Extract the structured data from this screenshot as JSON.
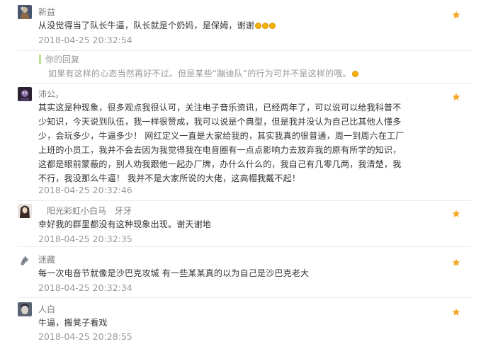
{
  "comments": [
    {
      "user": "新益",
      "text": "从没觉得当了队长牛逼，队长就是个奶妈，是保姆，谢谢",
      "time": "2018-04-25 20:32:54",
      "avatar_icon": "warrior-avatar-icon",
      "reply": {
        "title": "你的回复",
        "text": "如果有这样的心态当然再好不过。但是某些“蹦迪队”的行为可并不是这样的哦。"
      }
    },
    {
      "user": "沛公。",
      "text": "其实这是种现象，很多观点我很认可，关注电子音乐资讯，已经两年了，可以说可以给我科普不少知识，今天说到队伍，我一样很赞成，我可以说是个典型，但是我并没认为自己比其他人懂多少，会玩多少，牛逼多少！ 网红定义一直是大家给我的，其实我真的很普通，周一到周六在工厂上班的小员工，我并不会去因为我觉得我在电音圈有一点点影响力去放弃我的原有所学的知识，这都是眼前蒙蔽的，别人劝我跟他一起办厂牌，办什么什么的，我自己有几零几两，我清楚，我不行，我没那么牛逼！ 我并不是大家所说的大佬，这高帽我戴不起！",
      "time": "2018-04-25 20:32:46",
      "avatar_icon": "dark-avatar-icon"
    },
    {
      "user": "　阳光彩虹小白马　牙牙",
      "text": "幸好我的群里都没有这种现象出现。谢天谢地",
      "time": "2018-04-25 20:32:35",
      "avatar_icon": "girl-avatar-icon"
    },
    {
      "user": "迷藏",
      "text": "每一次电音节就像是沙巴克攻城 有一些某某真的以为自己是沙巴克老大",
      "time": "2018-04-25 20:32:34",
      "avatar_icon": "bird-avatar-icon"
    },
    {
      "user": "人白",
      "text": "牛逼，搬凳子看戏",
      "time": "2018-04-25 20:28:55",
      "avatar_icon": "face-avatar-icon"
    }
  ],
  "colors": {
    "star": "#f5a623",
    "reply_bar": "#b6e389",
    "meta_text": "#999999"
  },
  "icons": {
    "favorite": "star-icon",
    "emoji": "smile-emoji-icon"
  }
}
